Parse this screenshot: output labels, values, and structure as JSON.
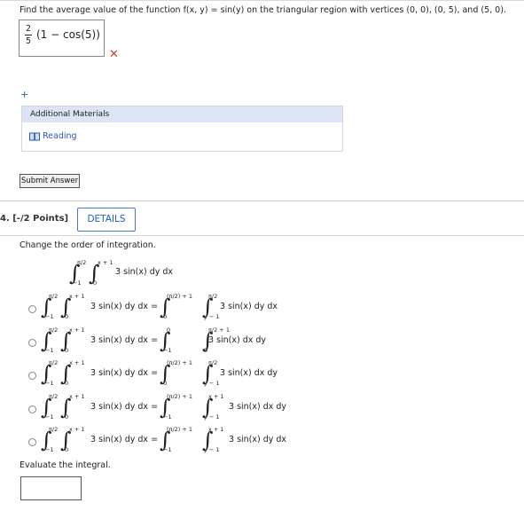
{
  "question_prev": {
    "text": "Find the average value of the function f(x, y) = sin(y) on the triangular region with vertices (0, 0), (0, 5), and (5, 0).",
    "answer_frac_num": "2",
    "answer_frac_den": "5",
    "answer_expr": "(1 − cos(5))",
    "result_icon": "cross-icon",
    "expand_icon": "+",
    "additional_materials_label": "Additional Materials",
    "reading_link": "Reading",
    "submit_label": "Submit Answer"
  },
  "question": {
    "number_label": "4.  [-/2 Points]",
    "details_label": "DETAILS",
    "instruction": "Change the order of integration.",
    "given": {
      "outer_upper": "π/2",
      "outer_lower": "−1",
      "inner_upper": "x + 1",
      "inner_lower": "0",
      "integrand": "3 sin(x) dy dx"
    },
    "options": [
      {
        "lhs_integrand": "3 sin(x) dy dx =",
        "outer_upper": "(π/2) + 1",
        "outer_lower": "0",
        "inner_upper": "π/2",
        "inner_lower": "y − 1",
        "rhs_integrand": "3 sin(x) dy dx"
      },
      {
        "lhs_integrand": "3 sin(x) dy dx =",
        "outer_upper": "0",
        "outer_lower": "−1",
        "inner_upper": "π/2 + 1",
        "inner_lower": "0",
        "rhs_integrand": "3 sin(x) dx dy"
      },
      {
        "lhs_integrand": "3 sin(x) dy dx =",
        "outer_upper": "(π/2) + 1",
        "outer_lower": "0",
        "inner_upper": "π/2",
        "inner_lower": "y − 1",
        "rhs_integrand": "3 sin(x) dx dy"
      },
      {
        "lhs_integrand": "3 sin(x) dy dx =",
        "outer_upper": "(π/2) + 1",
        "outer_lower": "−1",
        "inner_upper": "x + 1",
        "inner_lower": "y − 1",
        "rhs_integrand": "3 sin(x) dx dy"
      },
      {
        "lhs_integrand": "3 sin(x) dy dx =",
        "outer_upper": "(π/2) + 1",
        "outer_lower": "−1",
        "inner_upper": "x + 1",
        "inner_lower": "y − 1",
        "rhs_integrand": "3 sin(x) dy dx"
      }
    ],
    "evaluate_label": "Evaluate the integral.",
    "evaluate_value": ""
  }
}
